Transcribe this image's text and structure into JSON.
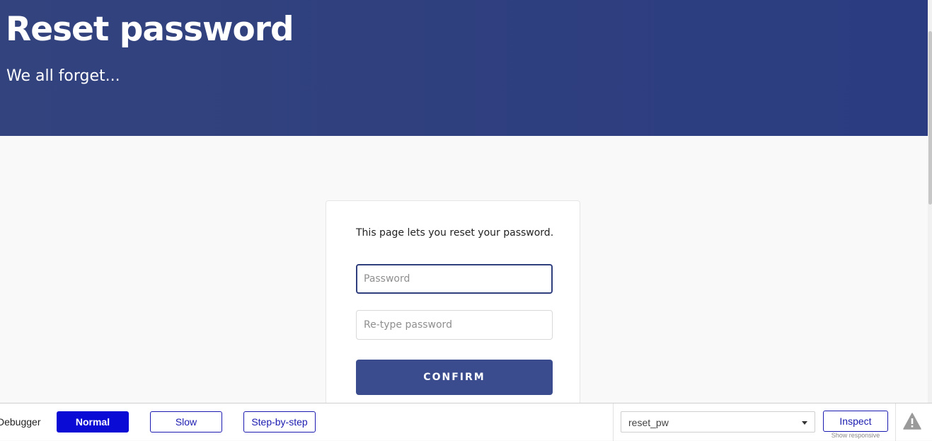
{
  "header": {
    "title": "Reset password",
    "subtitle": "We all forget..."
  },
  "card": {
    "intro": "This page lets you reset your password.",
    "password_placeholder": "Password",
    "retype_placeholder": "Re-type password",
    "confirm_label": "CONFIRM"
  },
  "debugger": {
    "label": "Debugger",
    "modes": {
      "normal": "Normal",
      "slow": "Slow",
      "step": "Step-by-step"
    },
    "active_mode": "Normal",
    "flow_value": "reset_pw",
    "inspect_label": "Inspect",
    "show_responsive": "Show responsive",
    "warning_icon": "warning-triangle-icon"
  },
  "colors": {
    "header_bg": "#2b3c80",
    "button_bg": "#3a4c8e",
    "mode_active": "#0b0bd6",
    "mode_outline": "#1a1ab0"
  }
}
